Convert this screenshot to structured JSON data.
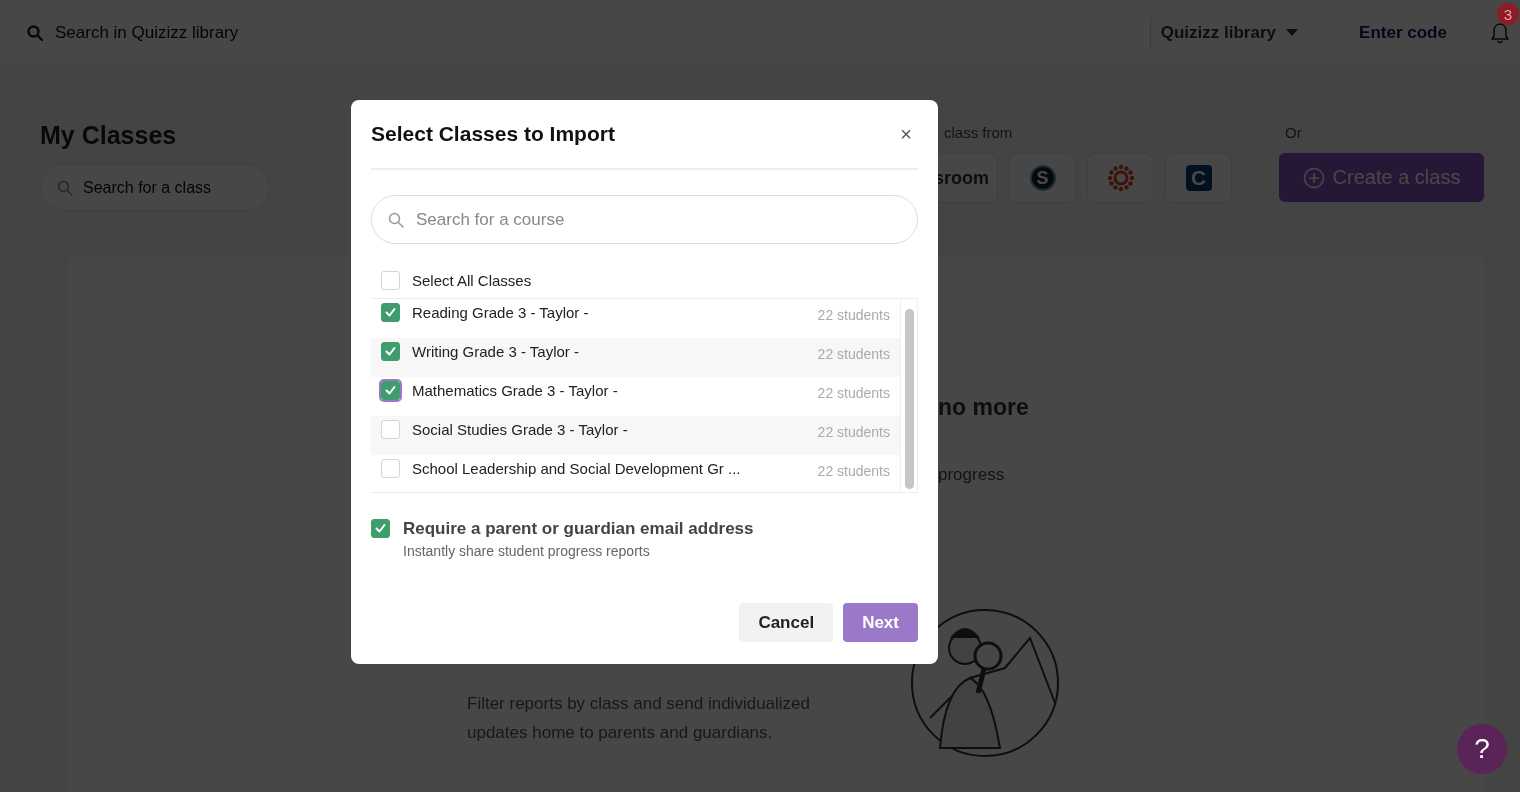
{
  "top_bar": {
    "search": {
      "placeholder": "Search in Quizizz library"
    },
    "library_dropdown": "Quizizz library",
    "enter_code": "Enter code",
    "notifications": "3"
  },
  "classes_panel": {
    "title": "My Classes",
    "search": {
      "placeholder": "Search for a class"
    }
  },
  "import": {
    "label": "class from",
    "providers": [
      {
        "kind": "text",
        "label": "sroom"
      },
      {
        "kind": "badge",
        "label": "S"
      },
      {
        "kind": "ring"
      },
      {
        "kind": "tile",
        "label": "C"
      }
    ]
  },
  "create": {
    "label": "Or",
    "button": "Create a class"
  },
  "feature_card": {
    "heading": "no more",
    "subtext": "progress",
    "description": "Filter reports by class and send individualized updates home to parents and guardians."
  },
  "help_button": "?",
  "modal": {
    "title": "Select Classes to Import",
    "close": "×",
    "search": {
      "placeholder": "Search for a course"
    },
    "select_all": {
      "label": "Select All Classes",
      "checked": false
    },
    "classes": [
      {
        "name": "Reading Grade 3 - Taylor -",
        "students": "22 students",
        "checked": true,
        "focused": false
      },
      {
        "name": "Writing Grade 3 - Taylor -",
        "students": "22 students",
        "checked": true,
        "focused": false
      },
      {
        "name": "Mathematics Grade 3 - Taylor -",
        "students": "22 students",
        "checked": true,
        "focused": true
      },
      {
        "name": "Social Studies Grade 3 - Taylor -",
        "students": "22 students",
        "checked": false,
        "focused": false
      },
      {
        "name": "School Leadership and Social Development Gr ...",
        "students": "22 students",
        "checked": false,
        "focused": false
      }
    ],
    "parent_email": {
      "checked": true,
      "title": "Require a parent or guardian email address",
      "subtitle": "Instantly share student progress reports"
    },
    "buttons": [
      {
        "kind": "secondary",
        "label": "Cancel"
      },
      {
        "kind": "primary",
        "label": "Next"
      }
    ]
  }
}
